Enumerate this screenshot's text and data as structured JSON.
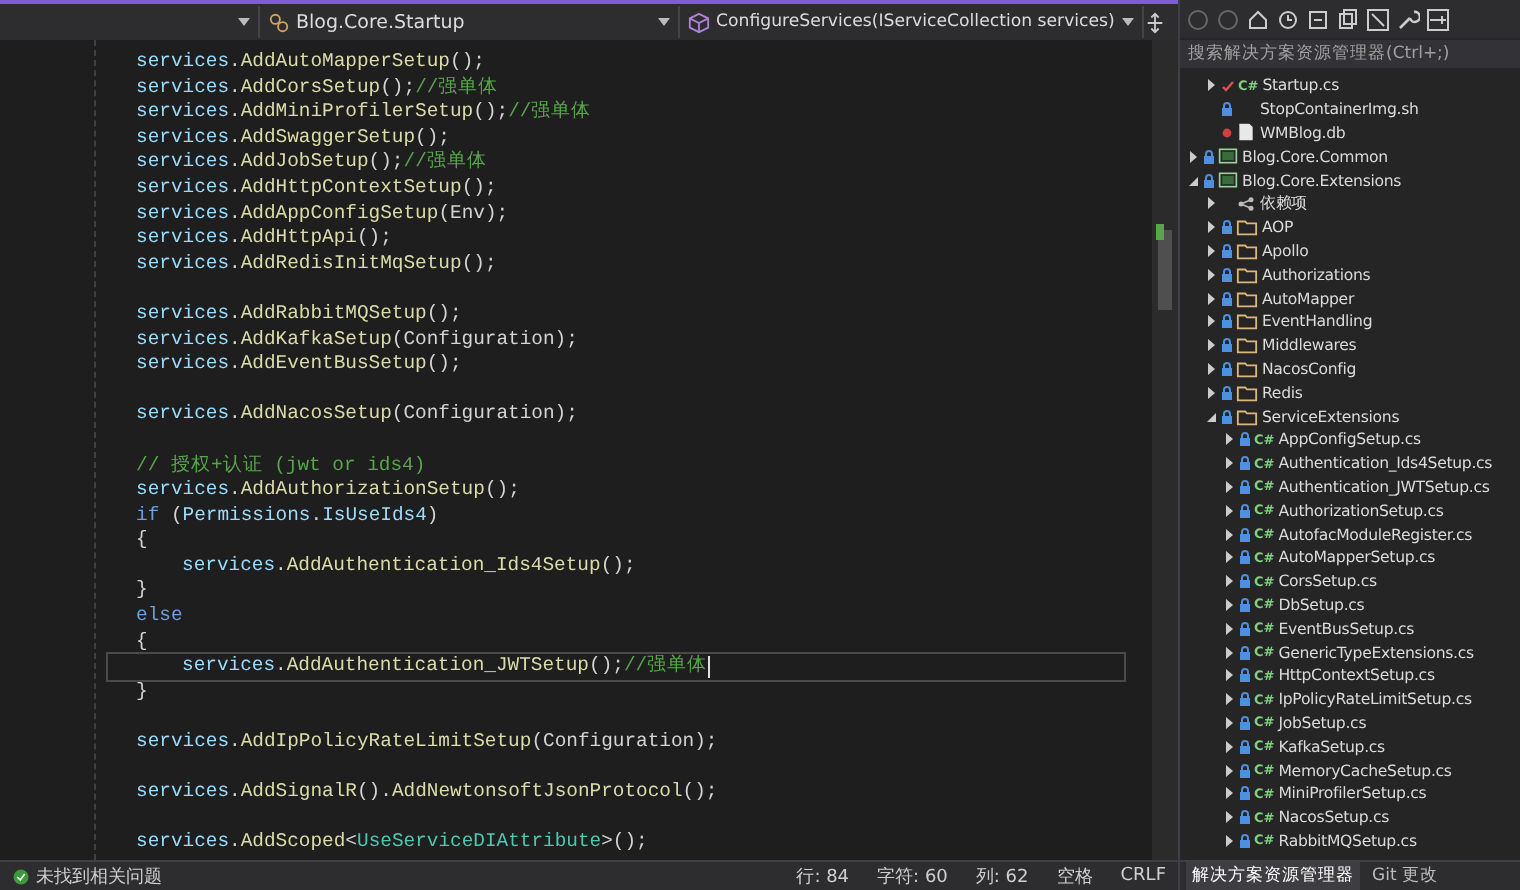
{
  "editor": {
    "nav": {
      "type": "Blog.Core.Startup",
      "member": "ConfigureServices(IServiceCollection services)"
    },
    "lines": [
      {
        "kind": "stmt",
        "current": false,
        "segments": [
          {
            "text": "services",
            "kind": "var"
          },
          {
            "text": ".",
            "kind": "plain"
          },
          {
            "text": "AddAutoMapperSetup",
            "kind": "method"
          },
          {
            "text": "();",
            "kind": "plain"
          }
        ]
      },
      {
        "kind": "stmt",
        "current": false,
        "segments": [
          {
            "text": "services",
            "kind": "var"
          },
          {
            "text": ".",
            "kind": "plain"
          },
          {
            "text": "AddCorsSetup",
            "kind": "method"
          },
          {
            "text": "();",
            "kind": "plain"
          },
          {
            "text": "//强单体",
            "kind": "comment"
          }
        ]
      },
      {
        "kind": "stmt",
        "current": false,
        "segments": [
          {
            "text": "services",
            "kind": "var"
          },
          {
            "text": ".",
            "kind": "plain"
          },
          {
            "text": "AddMiniProfilerSetup",
            "kind": "method"
          },
          {
            "text": "();",
            "kind": "plain"
          },
          {
            "text": "//强单体",
            "kind": "comment"
          }
        ]
      },
      {
        "kind": "stmt",
        "current": false,
        "segments": [
          {
            "text": "services",
            "kind": "var"
          },
          {
            "text": ".",
            "kind": "plain"
          },
          {
            "text": "AddSwaggerSetup",
            "kind": "method"
          },
          {
            "text": "();",
            "kind": "plain"
          }
        ]
      },
      {
        "kind": "stmt",
        "current": false,
        "segments": [
          {
            "text": "services",
            "kind": "var"
          },
          {
            "text": ".",
            "kind": "plain"
          },
          {
            "text": "AddJobSetup",
            "kind": "method"
          },
          {
            "text": "();",
            "kind": "plain"
          },
          {
            "text": "//强单体",
            "kind": "comment"
          }
        ]
      },
      {
        "kind": "stmt",
        "current": false,
        "segments": [
          {
            "text": "services",
            "kind": "var"
          },
          {
            "text": ".",
            "kind": "plain"
          },
          {
            "text": "AddHttpContextSetup",
            "kind": "method"
          },
          {
            "text": "();",
            "kind": "plain"
          }
        ]
      },
      {
        "kind": "stmt",
        "current": false,
        "segments": [
          {
            "text": "services",
            "kind": "var"
          },
          {
            "text": ".",
            "kind": "plain"
          },
          {
            "text": "AddAppConfigSetup",
            "kind": "method"
          },
          {
            "text": "(Env);",
            "kind": "plain"
          }
        ]
      },
      {
        "kind": "stmt",
        "current": false,
        "segments": [
          {
            "text": "services",
            "kind": "var"
          },
          {
            "text": ".",
            "kind": "plain"
          },
          {
            "text": "AddHttpApi",
            "kind": "method"
          },
          {
            "text": "();",
            "kind": "plain"
          }
        ]
      },
      {
        "kind": "stmt",
        "current": false,
        "segments": [
          {
            "text": "services",
            "kind": "var"
          },
          {
            "text": ".",
            "kind": "plain"
          },
          {
            "text": "AddRedisInitMqSetup",
            "kind": "method"
          },
          {
            "text": "();",
            "kind": "plain"
          }
        ]
      },
      {
        "kind": "blank"
      },
      {
        "kind": "stmt",
        "current": false,
        "segments": [
          {
            "text": "services",
            "kind": "var"
          },
          {
            "text": ".",
            "kind": "plain"
          },
          {
            "text": "AddRabbitMQSetup",
            "kind": "method"
          },
          {
            "text": "();",
            "kind": "plain"
          }
        ]
      },
      {
        "kind": "stmt",
        "current": false,
        "segments": [
          {
            "text": "services",
            "kind": "var"
          },
          {
            "text": ".",
            "kind": "plain"
          },
          {
            "text": "AddKafkaSetup",
            "kind": "method"
          },
          {
            "text": "(Configuration);",
            "kind": "plain"
          }
        ]
      },
      {
        "kind": "stmt",
        "current": false,
        "segments": [
          {
            "text": "services",
            "kind": "var"
          },
          {
            "text": ".",
            "kind": "plain"
          },
          {
            "text": "AddEventBusSetup",
            "kind": "method"
          },
          {
            "text": "();",
            "kind": "plain"
          }
        ]
      },
      {
        "kind": "blank"
      },
      {
        "kind": "stmt",
        "current": false,
        "segments": [
          {
            "text": "services",
            "kind": "var"
          },
          {
            "text": ".",
            "kind": "plain"
          },
          {
            "text": "AddNacosSetup",
            "kind": "method"
          },
          {
            "text": "(Configuration);",
            "kind": "plain"
          }
        ]
      },
      {
        "kind": "blank"
      },
      {
        "kind": "stmt",
        "current": false,
        "segments": [
          {
            "text": "// 授权+认证 (jwt or ids4)",
            "kind": "comment"
          }
        ]
      },
      {
        "kind": "stmt",
        "current": false,
        "segments": [
          {
            "text": "services",
            "kind": "var"
          },
          {
            "text": ".",
            "kind": "plain"
          },
          {
            "text": "AddAuthorizationSetup",
            "kind": "method"
          },
          {
            "text": "();",
            "kind": "plain"
          }
        ]
      },
      {
        "kind": "stmt",
        "current": false,
        "segments": [
          {
            "text": "if",
            "kind": "keyword"
          },
          {
            "text": " (",
            "kind": "plain"
          },
          {
            "text": "Permissions",
            "kind": "var"
          },
          {
            "text": ".",
            "kind": "plain"
          },
          {
            "text": "IsUseIds4",
            "kind": "var"
          },
          {
            "text": ")",
            "kind": "plain"
          }
        ]
      },
      {
        "kind": "stmt",
        "current": false,
        "segments": [
          {
            "text": "{",
            "kind": "plain"
          }
        ]
      },
      {
        "kind": "inner",
        "current": false,
        "segments": [
          {
            "text": "services",
            "kind": "var"
          },
          {
            "text": ".",
            "kind": "plain"
          },
          {
            "text": "AddAuthentication_Ids4Setup",
            "kind": "method"
          },
          {
            "text": "();",
            "kind": "plain"
          }
        ]
      },
      {
        "kind": "stmt",
        "current": false,
        "segments": [
          {
            "text": "}",
            "kind": "plain"
          }
        ]
      },
      {
        "kind": "stmt",
        "current": false,
        "segments": [
          {
            "text": "else",
            "kind": "keyword"
          }
        ]
      },
      {
        "kind": "stmt",
        "current": false,
        "segments": [
          {
            "text": "{",
            "kind": "plain"
          }
        ]
      },
      {
        "kind": "inner",
        "current": true,
        "segments": [
          {
            "text": "services",
            "kind": "var"
          },
          {
            "text": ".",
            "kind": "plain"
          },
          {
            "text": "AddAuthentication_JWTSetup",
            "kind": "method"
          },
          {
            "text": "();",
            "kind": "plain"
          },
          {
            "text": "//强单体",
            "kind": "comment"
          }
        ]
      },
      {
        "kind": "stmt",
        "current": false,
        "segments": [
          {
            "text": "}",
            "kind": "plain"
          }
        ]
      },
      {
        "kind": "blank"
      },
      {
        "kind": "stmt",
        "current": false,
        "segments": [
          {
            "text": "services",
            "kind": "var"
          },
          {
            "text": ".",
            "kind": "plain"
          },
          {
            "text": "AddIpPolicyRateLimitSetup",
            "kind": "method"
          },
          {
            "text": "(Configuration);",
            "kind": "plain"
          }
        ]
      },
      {
        "kind": "blank"
      },
      {
        "kind": "stmt",
        "current": false,
        "segments": [
          {
            "text": "services",
            "kind": "var"
          },
          {
            "text": ".",
            "kind": "plain"
          },
          {
            "text": "AddSignalR",
            "kind": "method"
          },
          {
            "text": "().",
            "kind": "plain"
          },
          {
            "text": "AddNewtonsoftJsonProtocol",
            "kind": "method"
          },
          {
            "text": "();",
            "kind": "plain"
          }
        ]
      },
      {
        "kind": "blank"
      },
      {
        "kind": "stmt",
        "current": false,
        "segments": [
          {
            "text": "services",
            "kind": "var"
          },
          {
            "text": ".",
            "kind": "plain"
          },
          {
            "text": "AddScoped",
            "kind": "method"
          },
          {
            "text": "<",
            "kind": "plain"
          },
          {
            "text": "UseServiceDIAttribute",
            "kind": "type"
          },
          {
            "text": ">();",
            "kind": "plain"
          }
        ]
      }
    ]
  },
  "status_bar": {
    "problems": "未找到相关问题",
    "line": "行: 84",
    "char": "字符: 60",
    "col": "列: 62",
    "indent": "空格",
    "eol": "CRLF"
  },
  "solution_explorer": {
    "search": {
      "placeholder": "搜索解决方案资源管理器(Ctrl+;)"
    },
    "continued_items": [
      {
        "name": "Startup.cs",
        "kind": "csharp",
        "icon": "C#",
        "marker": {
          "kind": "modified"
        },
        "expanded": false
      },
      {
        "name": "StopContainerImg.sh",
        "kind": "shell",
        "marker": {
          "kind": "locked"
        }
      },
      {
        "name": "WMBlog.db",
        "kind": "db",
        "marker": {
          "kind": "ignored"
        }
      }
    ],
    "items": [
      {
        "name": "Blog.Core.Common",
        "kind": "project",
        "marker": {
          "kind": "locked"
        },
        "expanded": false
      },
      {
        "name": "Blog.Core.Extensions",
        "kind": "project",
        "marker": {
          "kind": "locked"
        },
        "expanded": true,
        "children": [
          {
            "name": "依赖项",
            "kind": "deps",
            "expanded": false
          },
          {
            "name": "AOP",
            "kind": "folder",
            "marker": {
              "kind": "locked"
            },
            "expanded": false
          },
          {
            "name": "Apollo",
            "kind": "folder",
            "marker": {
              "kind": "locked"
            },
            "expanded": false
          },
          {
            "name": "Authorizations",
            "kind": "folder",
            "marker": {
              "kind": "locked"
            },
            "expanded": false
          },
          {
            "name": "AutoMapper",
            "kind": "folder",
            "marker": {
              "kind": "locked"
            },
            "expanded": false
          },
          {
            "name": "EventHandling",
            "kind": "folder",
            "marker": {
              "kind": "locked"
            },
            "expanded": false
          },
          {
            "name": "Middlewares",
            "kind": "folder",
            "marker": {
              "kind": "locked"
            },
            "expanded": false
          },
          {
            "name": "NacosConfig",
            "kind": "folder",
            "marker": {
              "kind": "locked"
            },
            "expanded": false
          },
          {
            "name": "Redis",
            "kind": "folder",
            "marker": {
              "kind": "locked"
            },
            "expanded": false
          },
          {
            "name": "ServiceExtensions",
            "kind": "folder",
            "marker": {
              "kind": "locked"
            },
            "expanded": true,
            "children": [
              {
                "name": "AppConfigSetup.cs",
                "kind": "csharp",
                "icon": "C#",
                "marker": {
                  "kind": "locked"
                },
                "expanded": false
              },
              {
                "name": "Authentication_Ids4Setup.cs",
                "kind": "csharp",
                "icon": "C#",
                "marker": {
                  "kind": "locked"
                },
                "expanded": false
              },
              {
                "name": "Authentication_JWTSetup.cs",
                "kind": "csharp",
                "icon": "C#",
                "marker": {
                  "kind": "locked"
                },
                "expanded": false
              },
              {
                "name": "AuthorizationSetup.cs",
                "kind": "csharp",
                "icon": "C#",
                "marker": {
                  "kind": "locked"
                },
                "expanded": false
              },
              {
                "name": "AutofacModuleRegister.cs",
                "kind": "csharp",
                "icon": "C#",
                "marker": {
                  "kind": "locked"
                },
                "expanded": false
              },
              {
                "name": "AutoMapperSetup.cs",
                "kind": "csharp",
                "icon": "C#",
                "marker": {
                  "kind": "locked"
                },
                "expanded": false
              },
              {
                "name": "CorsSetup.cs",
                "kind": "csharp",
                "icon": "C#",
                "marker": {
                  "kind": "locked"
                },
                "expanded": false
              },
              {
                "name": "DbSetup.cs",
                "kind": "csharp",
                "icon": "C#",
                "marker": {
                  "kind": "locked"
                },
                "expanded": false
              },
              {
                "name": "EventBusSetup.cs",
                "kind": "csharp",
                "icon": "C#",
                "marker": {
                  "kind": "locked"
                },
                "expanded": false
              },
              {
                "name": "GenericTypeExtensions.cs",
                "kind": "csharp",
                "icon": "C#",
                "marker": {
                  "kind": "locked"
                },
                "expanded": false
              },
              {
                "name": "HttpContextSetup.cs",
                "kind": "csharp",
                "icon": "C#",
                "marker": {
                  "kind": "locked"
                },
                "expanded": false
              },
              {
                "name": "IpPolicyRateLimitSetup.cs",
                "kind": "csharp",
                "icon": "C#",
                "marker": {
                  "kind": "locked"
                },
                "expanded": false
              },
              {
                "name": "JobSetup.cs",
                "kind": "csharp",
                "icon": "C#",
                "marker": {
                  "kind": "locked"
                },
                "expanded": false
              },
              {
                "name": "KafkaSetup.cs",
                "kind": "csharp",
                "icon": "C#",
                "marker": {
                  "kind": "locked"
                },
                "expanded": false
              },
              {
                "name": "MemoryCacheSetup.cs",
                "kind": "csharp",
                "icon": "C#",
                "marker": {
                  "kind": "locked"
                },
                "expanded": false
              },
              {
                "name": "MiniProfilerSetup.cs",
                "kind": "csharp",
                "icon": "C#",
                "marker": {
                  "kind": "locked"
                },
                "expanded": false
              },
              {
                "name": "NacosSetup.cs",
                "kind": "csharp",
                "icon": "C#",
                "marker": {
                  "kind": "locked"
                },
                "expanded": false
              },
              {
                "name": "RabbitMQSetup.cs",
                "kind": "csharp",
                "icon": "C#",
                "marker": {
                  "kind": "locked"
                },
                "expanded": false
              }
            ]
          }
        ]
      }
    ],
    "tabs": [
      {
        "label": "解决方案资源管理器",
        "selected": true
      },
      {
        "label": "Git 更改",
        "selected": false
      }
    ]
  }
}
